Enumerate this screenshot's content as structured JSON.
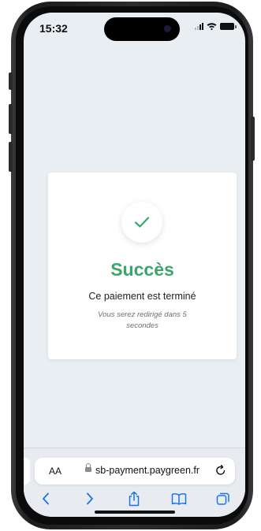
{
  "status_bar": {
    "time": "15:32"
  },
  "card": {
    "title": "Succès",
    "message": "Ce paiement est terminé",
    "redirect_note": "Vous serez redirigé dans 5 secondes"
  },
  "browser": {
    "text_size_label": "AA",
    "url": "sb-payment.paygreen.fr"
  },
  "icons": [
    "check-icon",
    "lock-icon",
    "reload-icon",
    "back-icon",
    "forward-icon",
    "share-icon",
    "bookmarks-icon",
    "tabs-icon"
  ],
  "colors": {
    "success": "#3aa66a",
    "accent": "#1a73e8",
    "background": "#e9eef3"
  }
}
